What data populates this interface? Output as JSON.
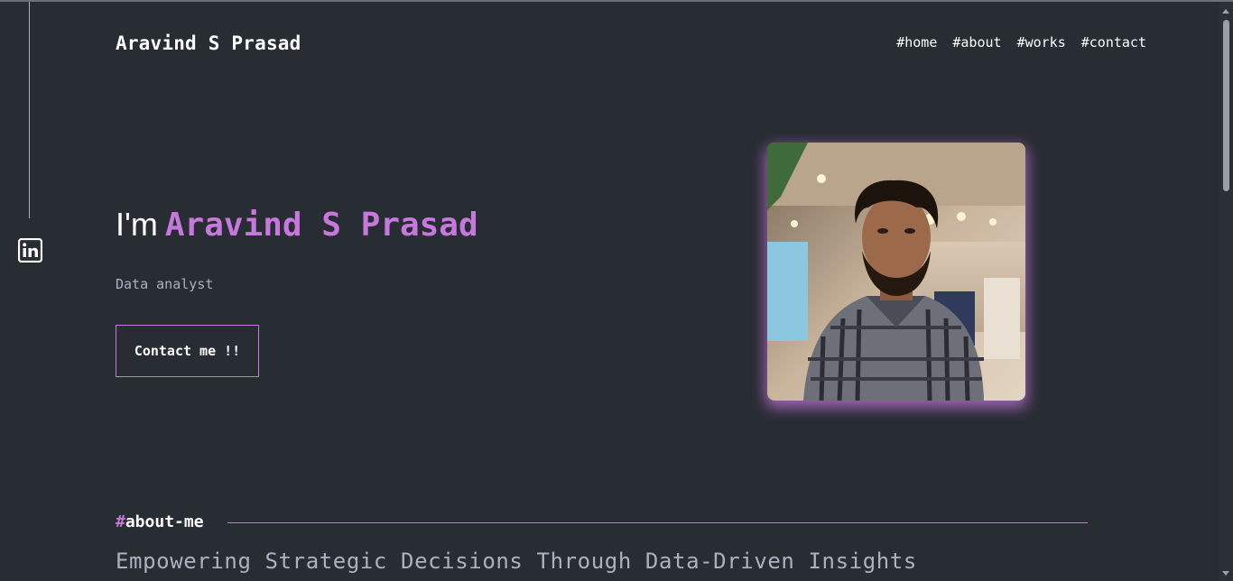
{
  "header": {
    "brand": "Aravind S Prasad",
    "nav": [
      "#home",
      "#about",
      "#works",
      "#contact"
    ]
  },
  "hero": {
    "greeting": "I'm",
    "name": "Aravind S Prasad",
    "role": "Data analyst",
    "cta_label": "Contact me !!"
  },
  "about": {
    "hash": "#",
    "title": "about-me",
    "tagline": "Empowering Strategic Decisions Through Data-Driven Insights"
  },
  "sidebar": {
    "icons": [
      "linkedin-icon"
    ]
  },
  "colors": {
    "background": "#282c33",
    "accent": "#c778dd",
    "text": "#ffffff",
    "muted": "#abb2bf"
  }
}
